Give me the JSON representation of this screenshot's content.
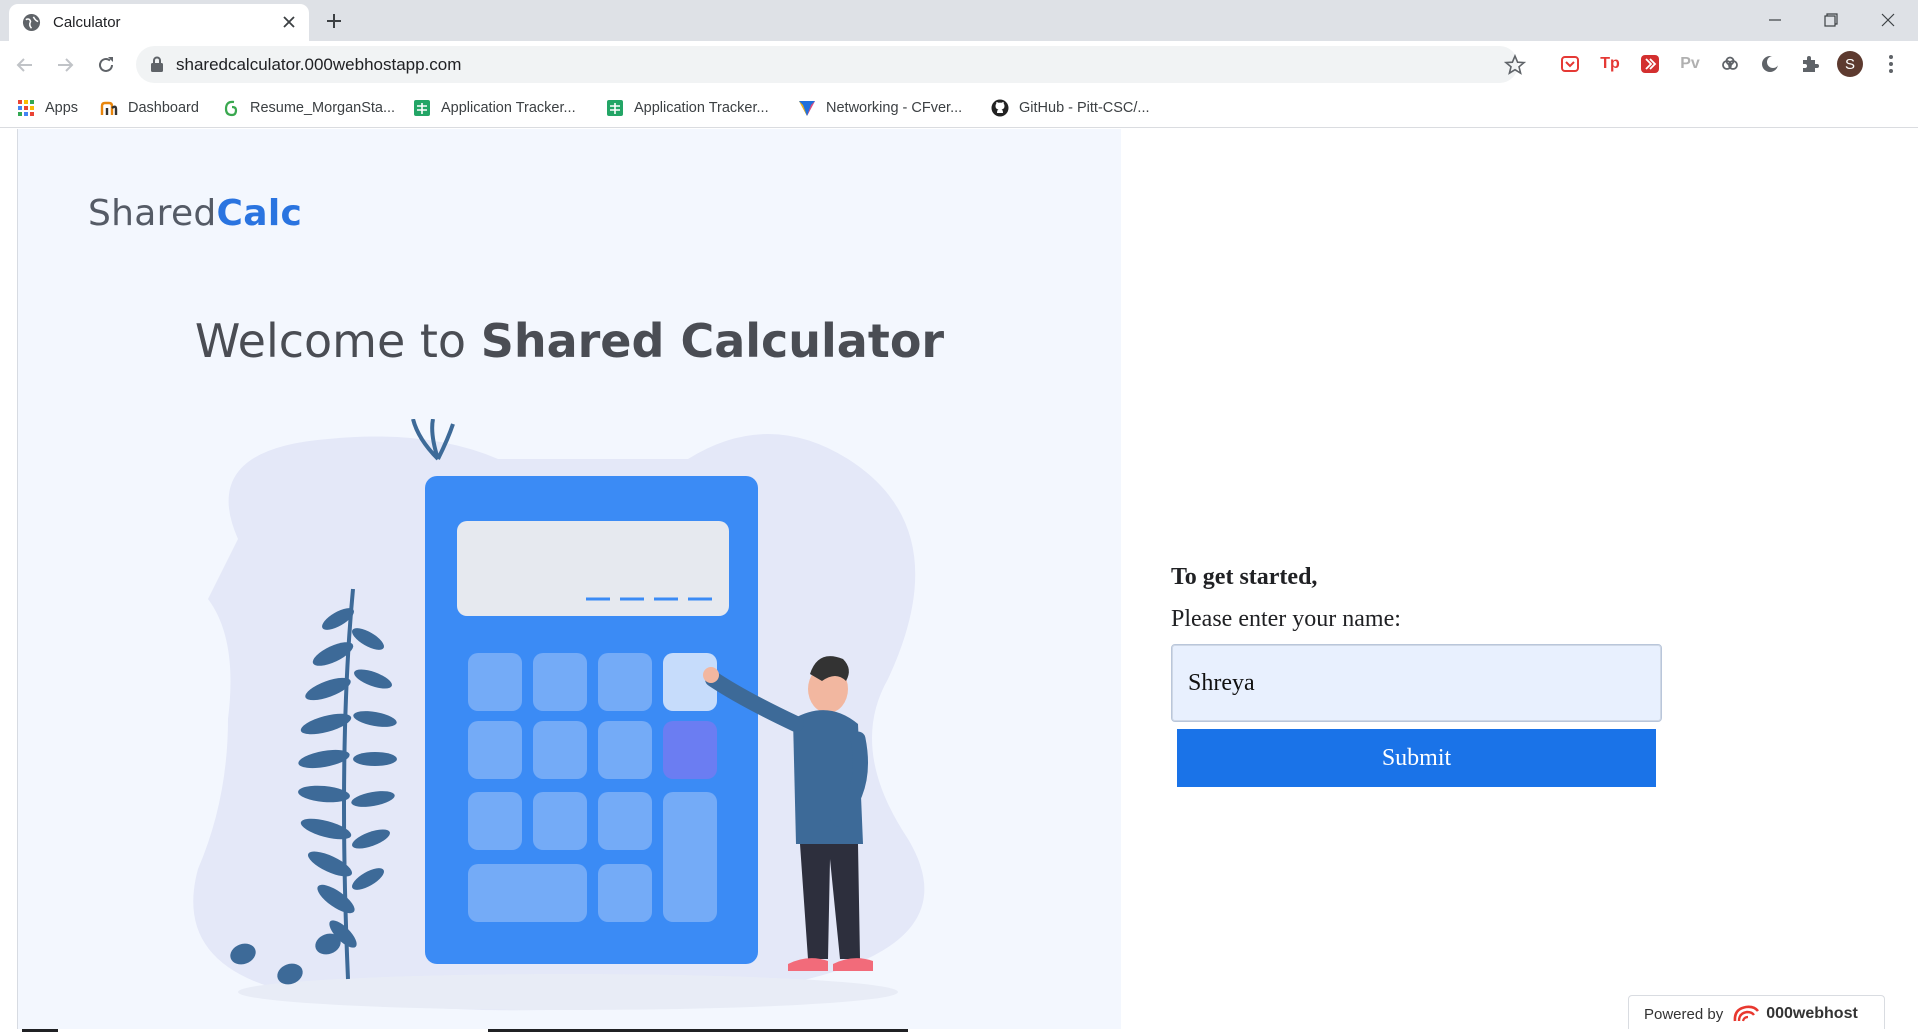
{
  "browser": {
    "tab_title": "Calculator",
    "url": "sharedcalculator.000webhostapp.com",
    "profile_initial": "S",
    "bookmarks": [
      {
        "label": "Apps",
        "icon": "apps-grid-icon"
      },
      {
        "label": "Dashboard",
        "icon": "dashboard-icon"
      },
      {
        "label": "Resume_MorganSta...",
        "icon": "resume-icon"
      },
      {
        "label": "Application Tracker...",
        "icon": "sheets-icon"
      },
      {
        "label": "Application Tracker...",
        "icon": "sheets-icon"
      },
      {
        "label": "Networking - CFver...",
        "icon": "networking-icon"
      },
      {
        "label": "GitHub - Pitt-CSC/...",
        "icon": "github-icon"
      }
    ],
    "extensions": [
      {
        "label": "",
        "icon": "pocket-icon",
        "color": "#e53935"
      },
      {
        "label": "Tp",
        "icon": "tp-icon",
        "color": "#e53935"
      },
      {
        "label": "",
        "icon": "extension-red-icon",
        "color": "#d32f2f"
      },
      {
        "label": "Pv",
        "icon": "pv-icon",
        "color": "#b0b0b0"
      },
      {
        "label": "",
        "icon": "cloud-link-icon",
        "color": "#5f6368"
      },
      {
        "label": "",
        "icon": "dark-mode-icon",
        "color": "#5f6368"
      },
      {
        "label": "",
        "icon": "puzzle-icon",
        "color": "#5f6368"
      }
    ]
  },
  "page": {
    "logo_plain": "Shared",
    "logo_bold": "Calc",
    "welcome_plain": "Welcome to ",
    "welcome_bold": "Shared Calculator",
    "form": {
      "heading": "To get started,",
      "label": "Please enter your name:",
      "name_value": "Shreya",
      "submit_label": "Submit"
    },
    "powered_by": {
      "prefix": "Powered by",
      "brand": "000webhost"
    }
  },
  "colors": {
    "accent": "#1a73e8",
    "logo_accent": "#2a74e0",
    "panel_bg": "#f3f7fe",
    "calculator": "#3b8bf5"
  }
}
